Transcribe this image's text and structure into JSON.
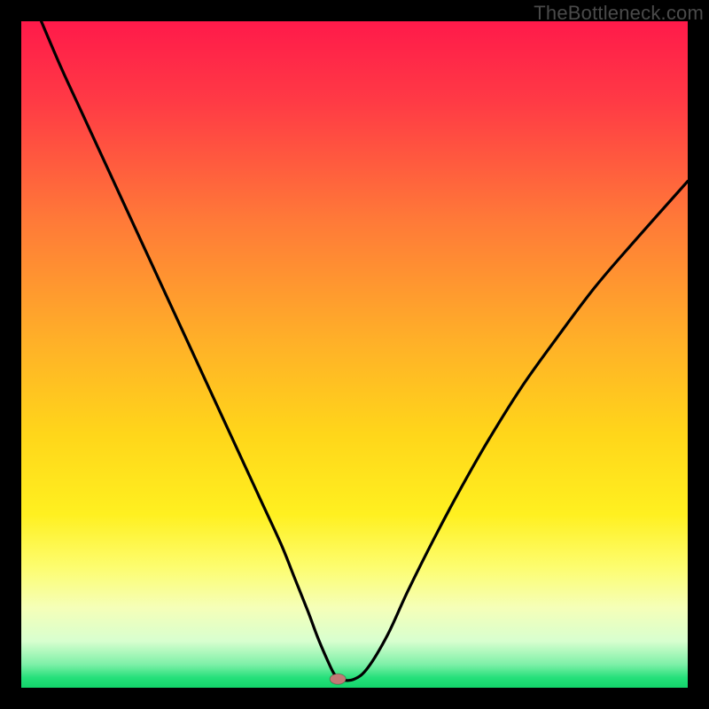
{
  "watermark": "TheBottleneck.com",
  "chart_data": {
    "type": "line",
    "title": "",
    "xlabel": "",
    "ylabel": "",
    "xlim": [
      0,
      100
    ],
    "ylim": [
      0,
      100
    ],
    "background_gradient": {
      "stops": [
        {
          "offset": 0.0,
          "color": "#ff1a4a"
        },
        {
          "offset": 0.12,
          "color": "#ff3a45"
        },
        {
          "offset": 0.3,
          "color": "#ff7a38"
        },
        {
          "offset": 0.48,
          "color": "#ffb028"
        },
        {
          "offset": 0.62,
          "color": "#ffd61a"
        },
        {
          "offset": 0.74,
          "color": "#fff020"
        },
        {
          "offset": 0.82,
          "color": "#fdfd70"
        },
        {
          "offset": 0.88,
          "color": "#f5ffb8"
        },
        {
          "offset": 0.93,
          "color": "#d8ffcf"
        },
        {
          "offset": 0.965,
          "color": "#7ef0a8"
        },
        {
          "offset": 0.985,
          "color": "#25e07a"
        },
        {
          "offset": 1.0,
          "color": "#13d46a"
        }
      ]
    },
    "series": [
      {
        "name": "bottleneck-curve",
        "color": "#000000",
        "x": [
          3,
          6,
          9,
          12,
          15,
          18,
          21,
          24,
          27,
          30,
          33,
          36,
          39,
          41,
          43,
          44.5,
          46,
          47,
          48,
          50,
          52,
          55,
          58,
          62,
          66,
          70,
          75,
          80,
          86,
          92,
          100
        ],
        "y": [
          100,
          93,
          86.5,
          80,
          73.5,
          67,
          60.5,
          54,
          47.5,
          41,
          34.5,
          28,
          21.5,
          16.5,
          11.5,
          7.5,
          4,
          2,
          1.2,
          1.3,
          3,
          8,
          14.5,
          22.5,
          30,
          37,
          45,
          52,
          60,
          67,
          76
        ]
      }
    ],
    "marker": {
      "name": "optimal-point",
      "x": 47.5,
      "y": 1.3,
      "rx": 9,
      "ry": 6,
      "color": "#c17a76"
    }
  }
}
